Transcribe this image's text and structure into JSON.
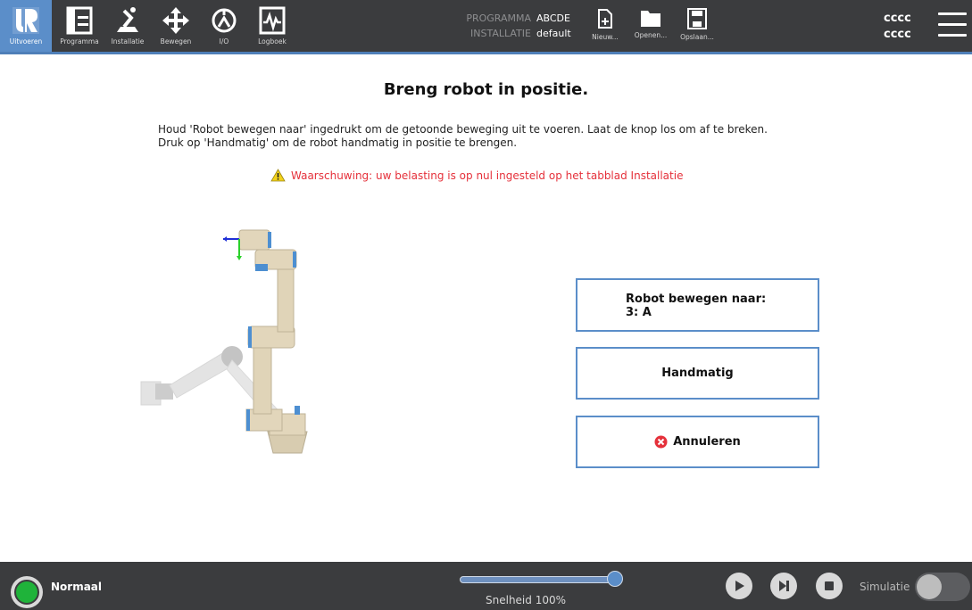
{
  "topbar": {
    "nav": [
      {
        "label": "Uitvoeren",
        "icon": "ur-logo-icon",
        "active": true
      },
      {
        "label": "Programma",
        "icon": "program-icon",
        "active": false
      },
      {
        "label": "Installatie",
        "icon": "installation-icon",
        "active": false
      },
      {
        "label": "Bewegen",
        "icon": "move-icon",
        "active": false
      },
      {
        "label": "I/O",
        "icon": "io-icon",
        "active": false
      },
      {
        "label": "Logboek",
        "icon": "log-icon",
        "active": false
      }
    ],
    "program_key": "PROGRAMMA",
    "program_value": "ABCDE",
    "installation_key": "INSTALLATIE",
    "installation_value": "default",
    "file_buttons": [
      {
        "label": "Nieuw...",
        "icon": "new-file-icon"
      },
      {
        "label": "Openen...",
        "icon": "folder-icon"
      },
      {
        "label": "Opslaan...",
        "icon": "save-icon"
      }
    ],
    "user_line1": "cccc",
    "user_line2": "cccc",
    "accent_color": "#5b8ec9"
  },
  "main": {
    "title": "Breng robot in positie.",
    "instruction_line1": "Houd 'Robot bewegen naar' ingedrukt om de getoonde beweging uit te voeren. Laat de knop los om af te breken.",
    "instruction_line2": "Druk op 'Handmatig' om de robot handmatig in positie te brengen.",
    "warning": "Waarschuwing: uw belasting is op nul ingesteld op het tabblad Installatie",
    "warning_color": "#e5303a",
    "move_button_line1": "Robot bewegen naar:",
    "move_button_line2": "3: A",
    "manual_button": "Handmatig",
    "cancel_button": "Annuleren"
  },
  "bottombar": {
    "status": "Normaal",
    "status_color": "#1fb33a",
    "speed_label": "Snelheid 100%",
    "speed_percent": 100,
    "simulation_label": "Simulatie",
    "simulation_on": false
  }
}
